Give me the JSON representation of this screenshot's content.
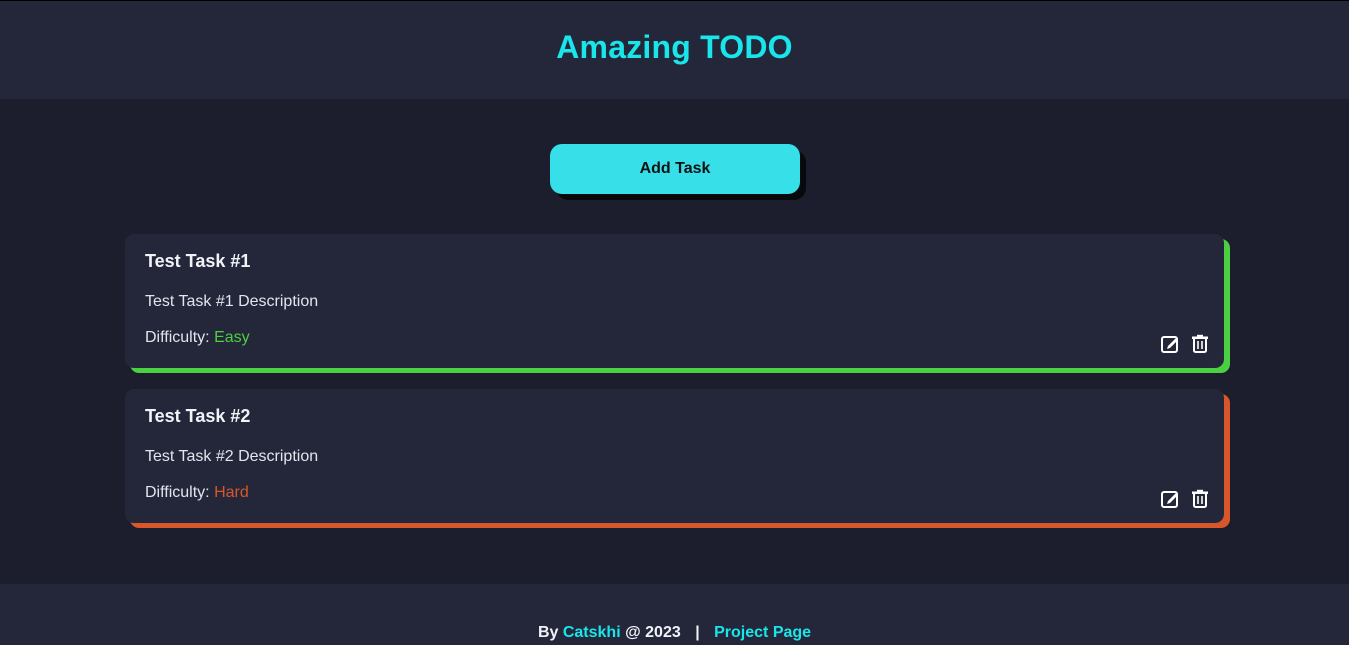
{
  "header": {
    "title": "Amazing TODO"
  },
  "actions": {
    "add_task_label": "Add Task"
  },
  "tasks": [
    {
      "title": "Test Task #1",
      "description": "Test Task #1 Description",
      "difficulty_label": "Difficulty:",
      "difficulty": "Easy",
      "accent_color": "#4bd041",
      "edit_icon": "edit-icon",
      "delete_icon": "trash-icon"
    },
    {
      "title": "Test Task #2",
      "description": "Test Task #2 Description",
      "difficulty_label": "Difficulty:",
      "difficulty": "Hard",
      "accent_color": "#d8572a",
      "edit_icon": "edit-icon",
      "delete_icon": "trash-icon"
    }
  ],
  "footer": {
    "by_text": "By",
    "author": "Catskhi",
    "year_text": "@ 2023",
    "separator": "|",
    "project_link": "Project Page"
  },
  "colors": {
    "accent": "#19e6ea",
    "button": "#37dfe9",
    "background": "#1c1e2d",
    "panel": "#242739"
  }
}
